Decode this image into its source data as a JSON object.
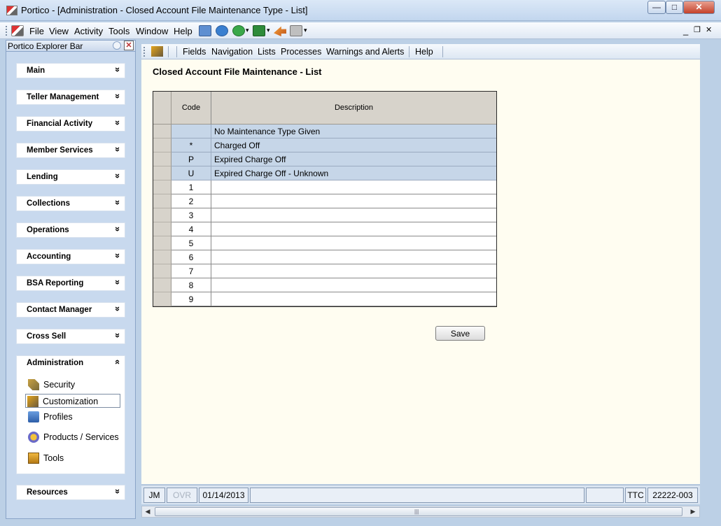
{
  "window": {
    "title": "Portico - [Administration - Closed Account File Maintenance Type - List]",
    "controls": {
      "minimize": "—",
      "maximize": "□",
      "close": "✕"
    }
  },
  "menubar": {
    "items": [
      "File",
      "View",
      "Activity",
      "Tools",
      "Window",
      "Help"
    ],
    "doc_controls": {
      "minimize": "_",
      "restore": "❐",
      "close": "✕"
    }
  },
  "explorer": {
    "title": "Portico Explorer Bar",
    "sections": [
      "Main",
      "Teller Management",
      "Financial Activity",
      "Member Services",
      "Lending",
      "Collections",
      "Operations",
      "Accounting",
      "BSA Reporting",
      "Contact Manager",
      "Cross Sell"
    ],
    "admin": {
      "label": "Administration",
      "items": [
        "Security",
        "Customization",
        "Profiles",
        "Products / Services",
        "Tools"
      ]
    },
    "resources": "Resources",
    "chev_down": "»",
    "chev_up": "«"
  },
  "content_toolbar": {
    "items": [
      "Fields",
      "Navigation",
      "Lists",
      "Processes",
      "Warnings and Alerts",
      "Help"
    ]
  },
  "page": {
    "title": "Closed Account File Maintenance - List",
    "table": {
      "columns": [
        "Code",
        "Description"
      ],
      "rows": [
        {
          "code": "",
          "description": "No Maintenance Type Given"
        },
        {
          "code": "*",
          "description": "Charged Off"
        },
        {
          "code": "P",
          "description": "Expired Charge Off"
        },
        {
          "code": "U",
          "description": "Expired Charge Off - Unknown"
        },
        {
          "code": "1",
          "description": ""
        },
        {
          "code": "2",
          "description": ""
        },
        {
          "code": "3",
          "description": ""
        },
        {
          "code": "4",
          "description": ""
        },
        {
          "code": "5",
          "description": ""
        },
        {
          "code": "6",
          "description": ""
        },
        {
          "code": "7",
          "description": ""
        },
        {
          "code": "8",
          "description": ""
        },
        {
          "code": "9",
          "description": ""
        }
      ]
    },
    "save_label": "Save"
  },
  "statusbar": {
    "user": "JM",
    "ovr": "OVR",
    "date": "01/14/2013",
    "ttc": "TTC",
    "branch": "22222-003"
  },
  "scroll": {
    "left": "◀",
    "right": "▶",
    "grip": "|||"
  }
}
